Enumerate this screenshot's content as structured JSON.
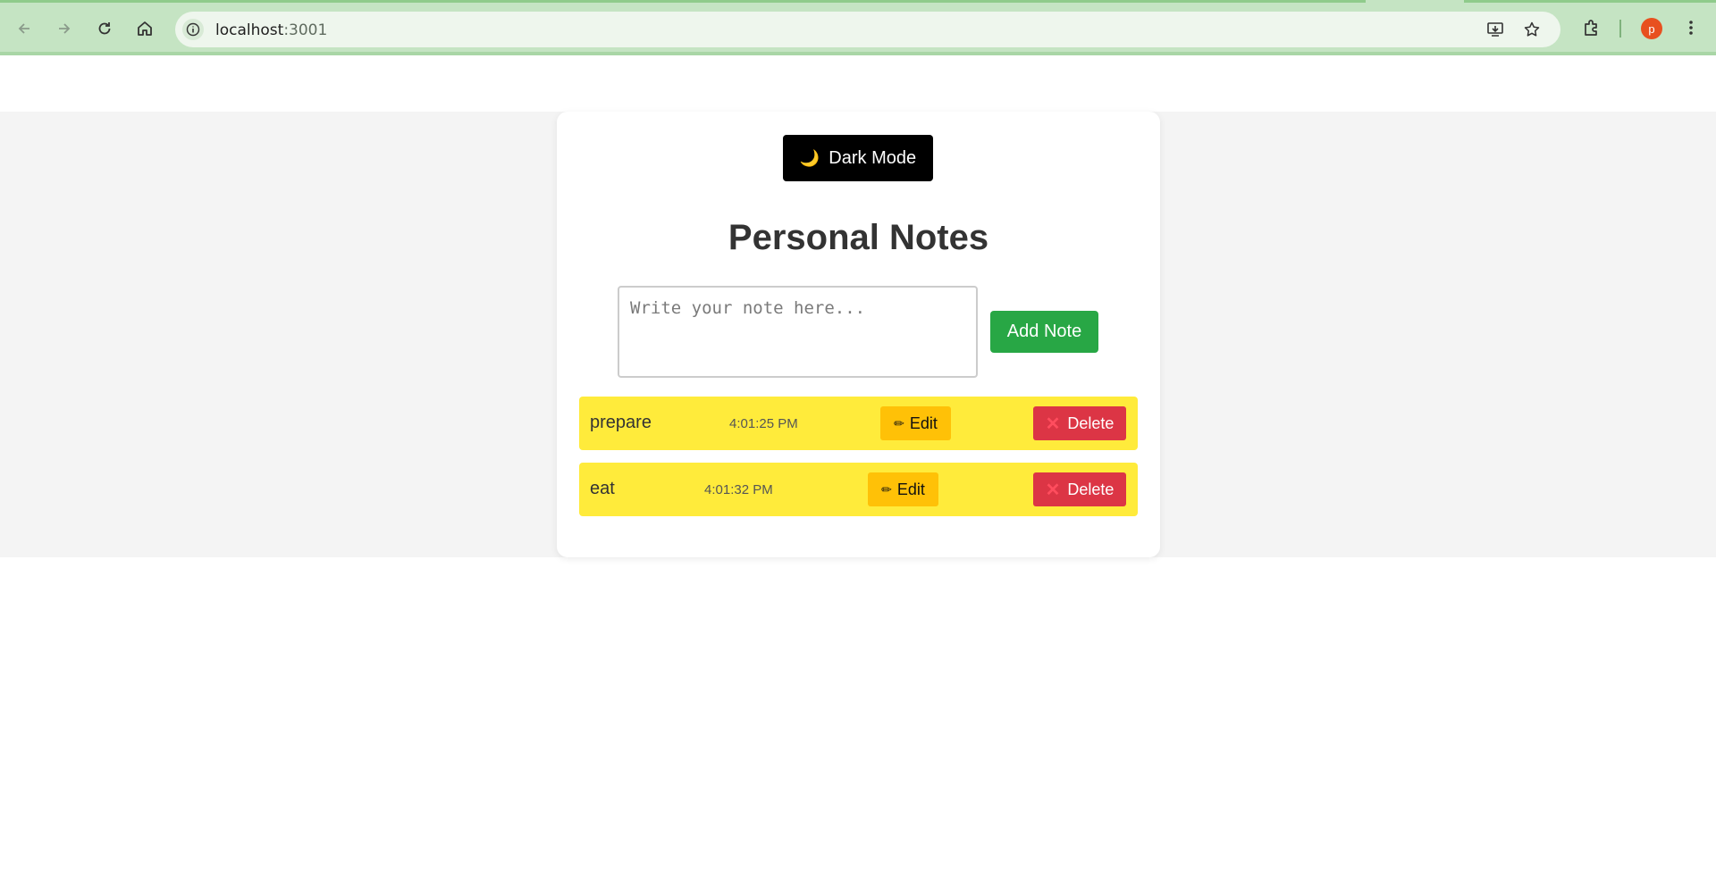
{
  "browser": {
    "url_host": "localhost",
    "url_port": ":3001",
    "avatar_letter": "p"
  },
  "app": {
    "dark_mode_label": "Dark Mode",
    "moon_glyph": "🌙",
    "title": "Personal Notes",
    "note_placeholder": "Write your note here...",
    "add_button_label": "Add Note"
  },
  "notes": [
    {
      "text": "prepare",
      "time": "4:01:25 PM",
      "edit_label": "Edit",
      "delete_label": "Delete"
    },
    {
      "text": "eat",
      "time": "4:01:32 PM",
      "edit_label": "Edit",
      "delete_label": "Delete"
    }
  ],
  "icons": {
    "edit": "pencil-icon",
    "delete": "cross-icon"
  },
  "colors": {
    "note_bg": "#ffeb3b",
    "add_button": "#28a745",
    "edit_button": "#ffc107",
    "delete_button": "#dc3545",
    "dark_button": "#000000",
    "chrome": "#c5e4c3"
  }
}
